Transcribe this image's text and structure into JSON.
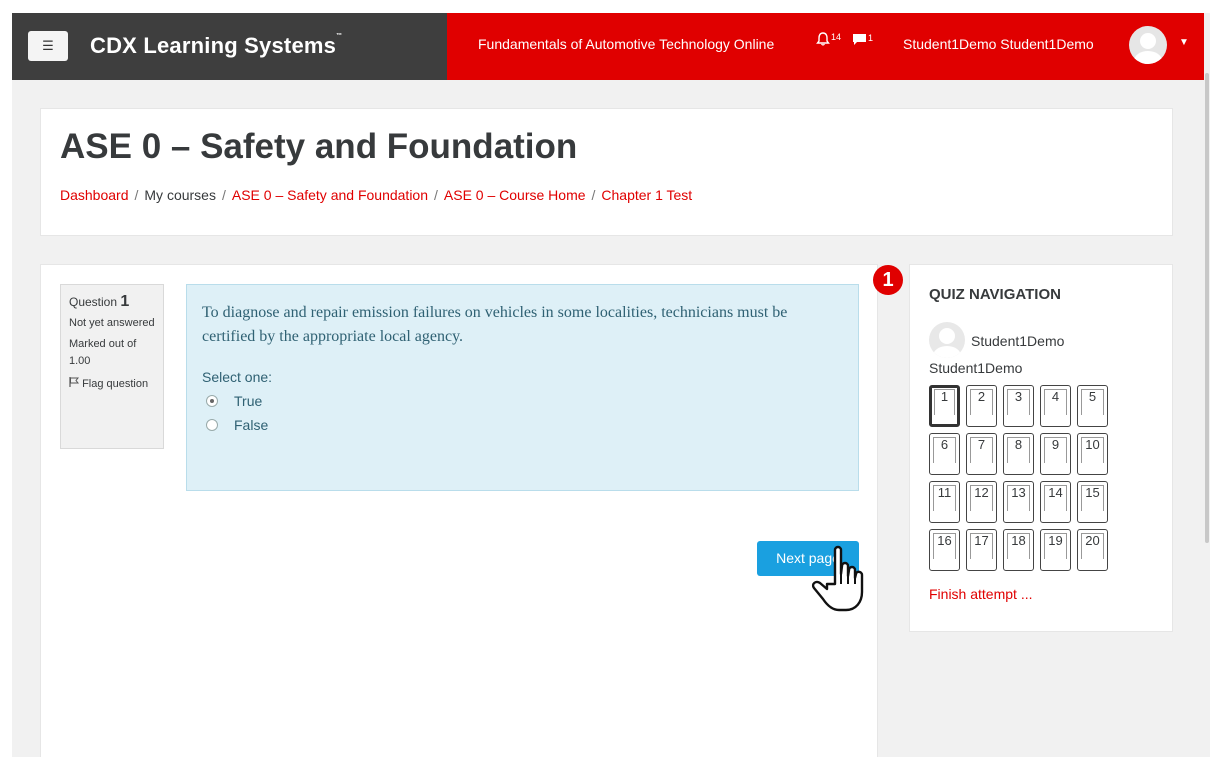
{
  "navbar": {
    "menu_icon": "hamburger-icon",
    "menu_glyph": "☰",
    "brand": "CDX Learning Systems",
    "course_link": "Fundamentals of Automotive Technology Online",
    "notifications_count": "14",
    "messages_count": "1",
    "user_name": "Student1Demo Student1Demo",
    "colors": {
      "left": "#3e3e3e",
      "right": "#e00000"
    }
  },
  "header": {
    "title": "ASE 0 – Safety and Foundation",
    "breadcrumb": [
      {
        "label": "Dashboard",
        "link": true
      },
      {
        "label": "My courses",
        "link": false
      },
      {
        "label": "ASE 0 – Safety and Foundation",
        "link": true
      },
      {
        "label": "ASE 0 – Course Home",
        "link": true
      },
      {
        "label": "Chapter 1 Test",
        "link": true
      }
    ]
  },
  "question": {
    "label": "Question",
    "number": "1",
    "status": "Not yet answered",
    "marked": "Marked out of 1.00",
    "flag": "Flag question",
    "text": "To diagnose and repair emission failures on vehicles in some localities, technicians must be certified by the appropriate local agency.",
    "select_label": "Select one:",
    "options": [
      {
        "label": "True",
        "selected": true
      },
      {
        "label": "False",
        "selected": false
      }
    ]
  },
  "next_button": "Next page",
  "quiz_nav": {
    "badge": "1",
    "title": "QUIZ NAVIGATION",
    "user": "Student1Demo Student1Demo",
    "questions": [
      "1",
      "2",
      "3",
      "4",
      "5",
      "6",
      "7",
      "8",
      "9",
      "10",
      "11",
      "12",
      "13",
      "14",
      "15",
      "16",
      "17",
      "18",
      "19",
      "20"
    ],
    "current": "1",
    "finish": "Finish attempt ..."
  }
}
